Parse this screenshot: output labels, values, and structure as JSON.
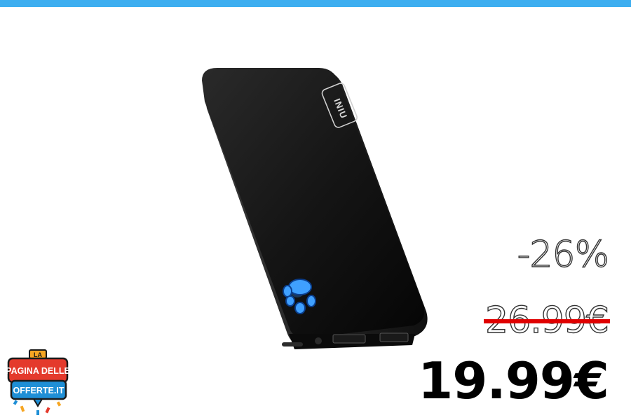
{
  "product": {
    "brand_label": "INIU",
    "image_icon": "power-bank-image",
    "led_icon": "paw-icon",
    "led_color": "#3fa0ff"
  },
  "pricing": {
    "discount": "-26%",
    "old_price": "26.99€",
    "new_price": "19.99€",
    "strike_color": "#e00000"
  },
  "logo": {
    "line1": "LA",
    "line2": "PAGINA DELLE",
    "line3": "OFFERTE.IT"
  },
  "colors": {
    "top_bar": "#3daef0"
  }
}
